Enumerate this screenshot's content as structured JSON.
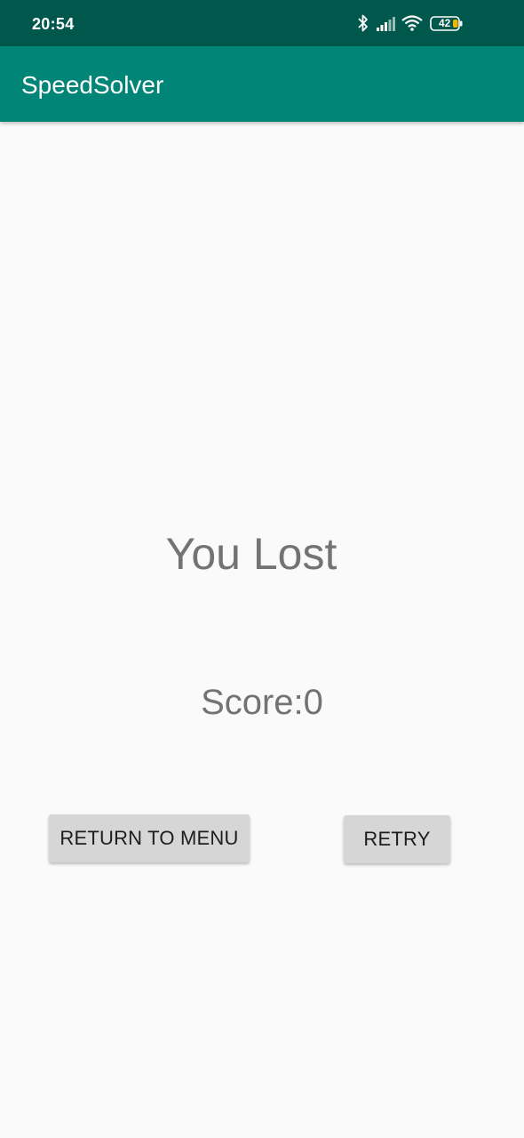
{
  "status_bar": {
    "time": "20:54",
    "battery_level": "42",
    "icons": [
      "bluetooth-icon",
      "signal-icon",
      "wifi-icon",
      "battery-icon"
    ]
  },
  "app_bar": {
    "title": "SpeedSolver"
  },
  "result": {
    "title": "You Lost",
    "score_label": "Score:0"
  },
  "actions": {
    "return_label": "RETURN TO MENU",
    "retry_label": "RETRY"
  },
  "colors": {
    "status_bar": "#00574b",
    "app_bar": "#008577",
    "background": "#fafafa",
    "button": "#d6d6d6",
    "text_gray": "#737373"
  }
}
